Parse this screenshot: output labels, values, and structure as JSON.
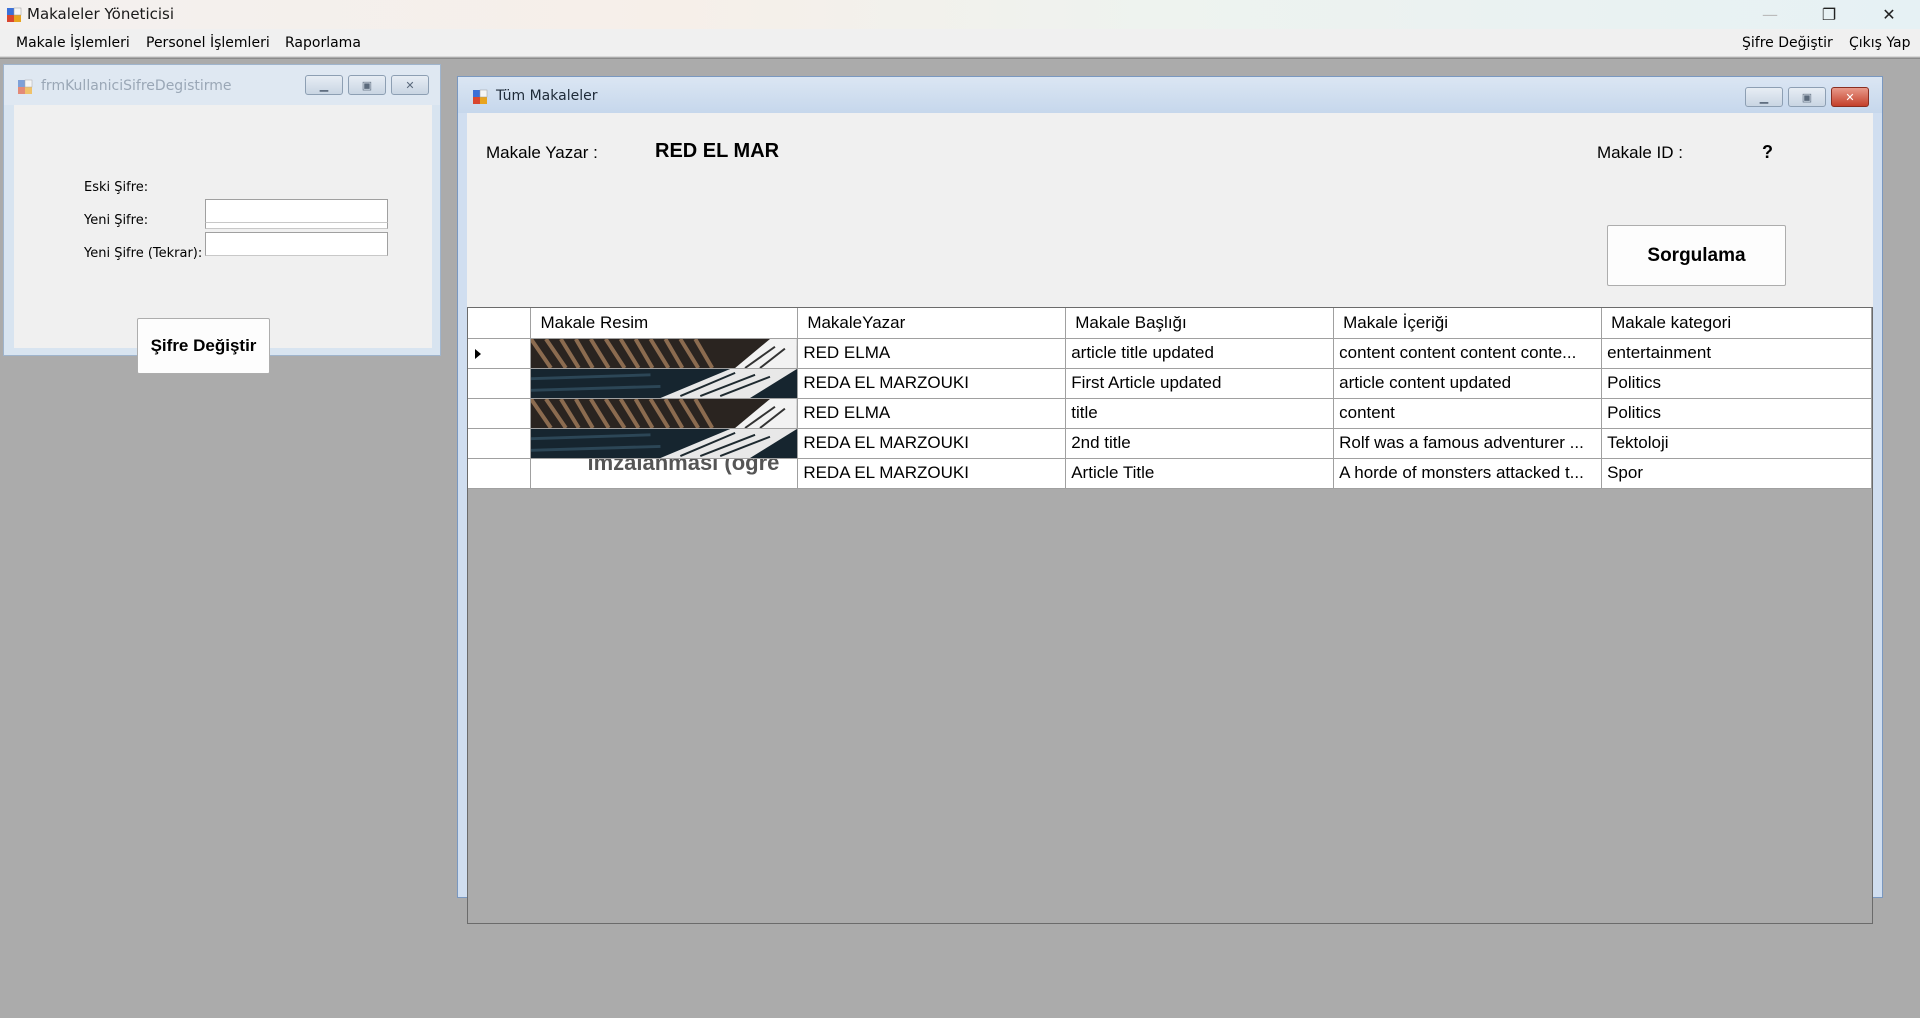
{
  "window": {
    "title": "Makaleler Yöneticisi"
  },
  "menu": {
    "left": [
      "Makale İşlemleri",
      "Personel İşlemleri",
      "Raporlama"
    ],
    "right": [
      "Şifre Değiştir",
      "Çıkış Yap"
    ]
  },
  "password_form": {
    "title": "frmKullaniciSifreDegistirme",
    "old_label": "Eski Şifre:",
    "new_label": "Yeni Şifre:",
    "repeat_label": "Yeni Şifre (Tekrar):",
    "old_value": "",
    "new_value": "",
    "repeat_value": "",
    "submit_label": "Şifre Değiştir"
  },
  "articles": {
    "title": "Tüm Makaleler",
    "author_label": "Makale Yazar :",
    "author_value": "RED EL MAR",
    "id_label": "Makale ID :",
    "id_value": "?",
    "query_button": "Sorgulama",
    "columns": [
      "Makale Resim",
      "MakaleYazar",
      "Makale Başlığı",
      "Makale İçeriği",
      "Makale kategori"
    ],
    "rows": [
      {
        "author": "RED ELMA",
        "title": "article title updated",
        "content": "content content content conte...",
        "category": "entertainment",
        "image": "photo-dark"
      },
      {
        "author": "REDA EL MARZOUKI",
        "title": "First Article updated",
        "content": "article content updated",
        "category": "Politics",
        "image": "photo-banknote"
      },
      {
        "author": "RED ELMA",
        "title": "title",
        "content": "content",
        "category": "Politics",
        "image": "photo-dark"
      },
      {
        "author": "REDA EL MARZOUKI",
        "title": "2nd title",
        "content": "Rolf was a famous adventurer ...",
        "category": "Tektoloji",
        "image": "photo-banknote"
      },
      {
        "author": "REDA EL MARZOUKI",
        "title": "Article Title",
        "content": "A horde of monsters attacked t...",
        "category": "Spor",
        "image": "photo-text",
        "image_text": "imzalanması (öğre"
      }
    ]
  },
  "colors": {
    "accent_close": "#c4402a",
    "mdi_background": "#ababab"
  }
}
